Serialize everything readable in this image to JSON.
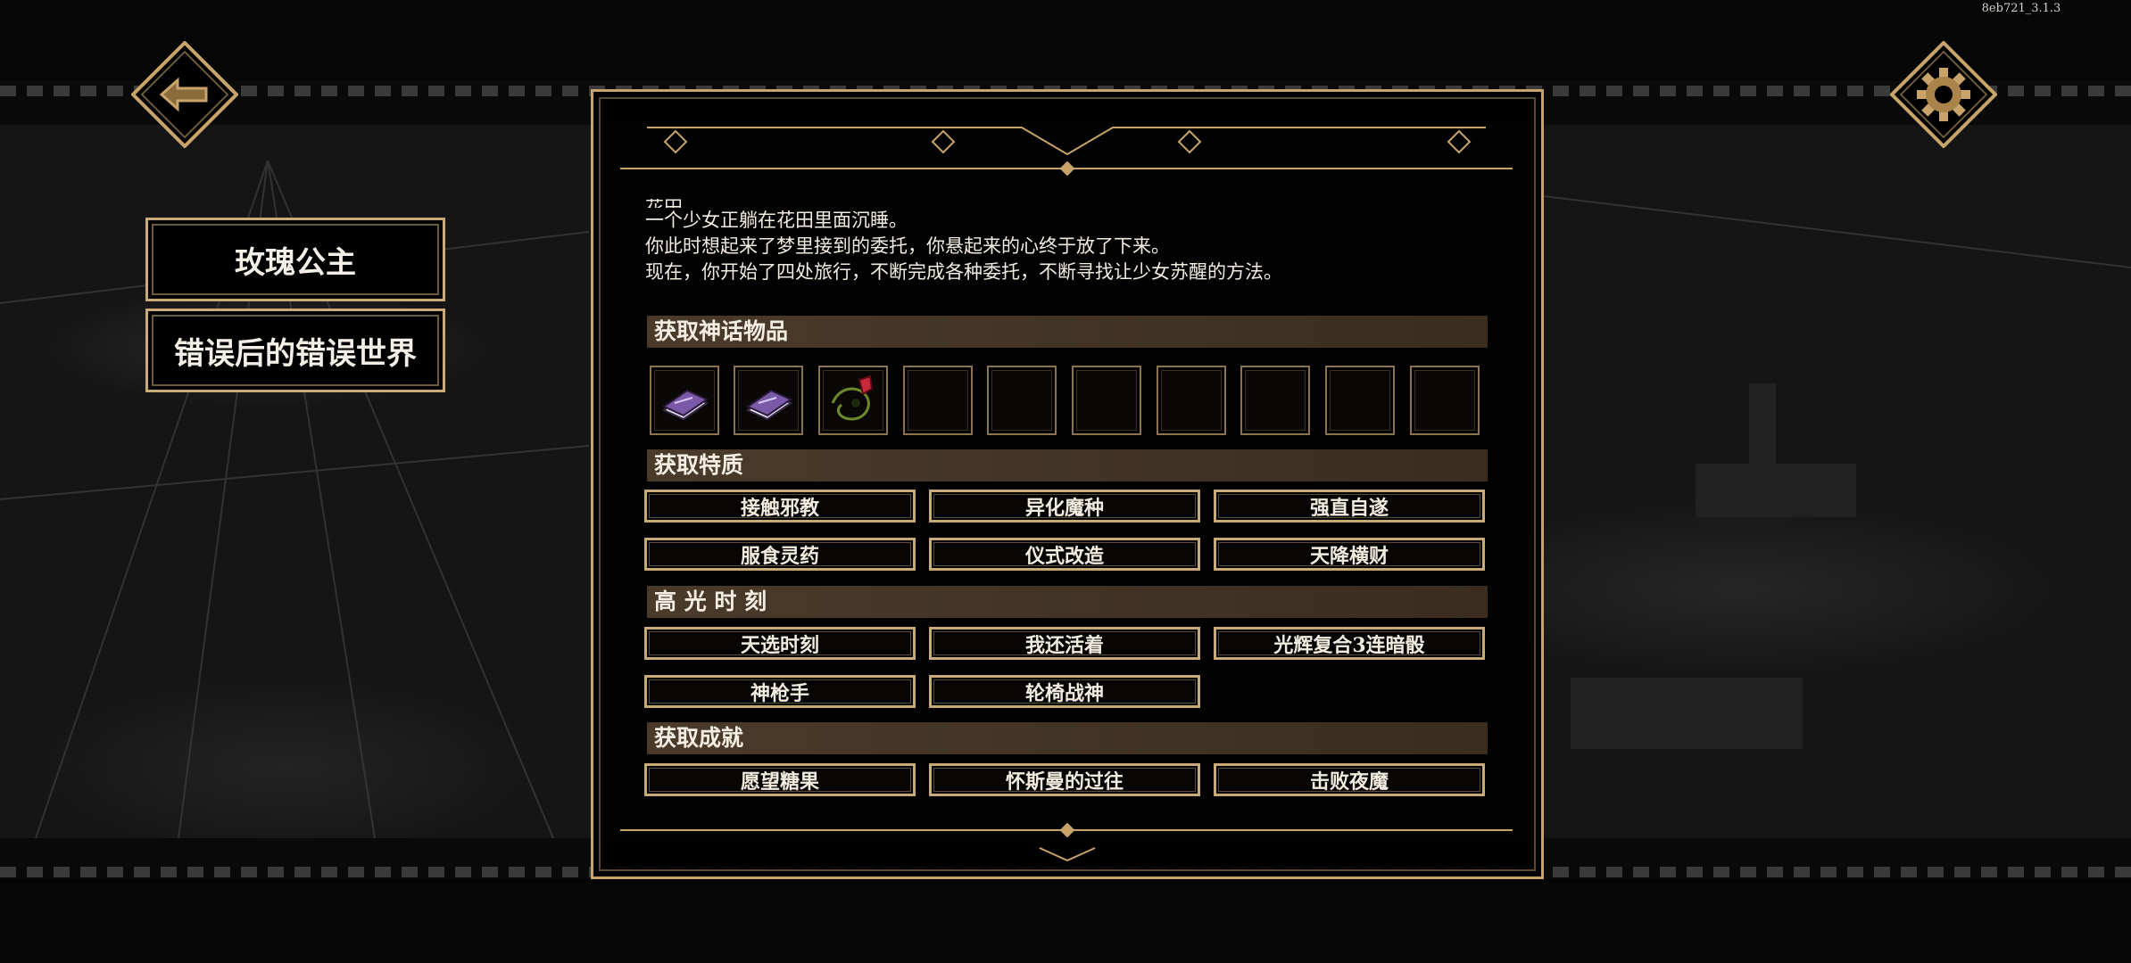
{
  "version": "8eb721_3.1.3",
  "colors": {
    "gold": "#c9a46a",
    "section_bg": "#4a3a2a",
    "text": "#f2ece1"
  },
  "nav": {
    "back_icon": "back-arrow-icon",
    "settings_icon": "gear-icon"
  },
  "side_tabs": [
    {
      "label": "玫瑰公主"
    },
    {
      "label": "错误后的错误世界"
    }
  ],
  "story": {
    "cut_line": "花田。",
    "lines": [
      "一个少女正躺在花田里面沉睡。",
      "你此时想起来了梦里接到的委托，你悬起来的心终于放了下来。",
      "现在，你开始了四处旅行，不断完成各种委托，不断寻找让少女苏醒的方法。"
    ]
  },
  "sections": {
    "items": {
      "title": "获取神话物品",
      "slots": [
        {
          "icon": "purple-book-icon"
        },
        {
          "icon": "purple-book-icon"
        },
        {
          "icon": "red-rose-vine-icon"
        },
        {
          "icon": ""
        },
        {
          "icon": ""
        },
        {
          "icon": ""
        },
        {
          "icon": ""
        },
        {
          "icon": ""
        },
        {
          "icon": ""
        },
        {
          "icon": ""
        }
      ]
    },
    "traits": {
      "title": "获取特质",
      "chips": [
        "接触邪教",
        "异化魔种",
        "强直自遂",
        "服食灵药",
        "仪式改造",
        "天降横财"
      ]
    },
    "highlights": {
      "title": "高 光 时 刻",
      "chips": [
        "天选时刻",
        "我还活着",
        "光辉复合3连暗骰",
        "神枪手",
        "轮椅战神"
      ]
    },
    "achievements": {
      "title": "获取成就",
      "chips": [
        "愿望糖果",
        "怀斯曼的过往",
        "击败夜魔"
      ]
    }
  }
}
